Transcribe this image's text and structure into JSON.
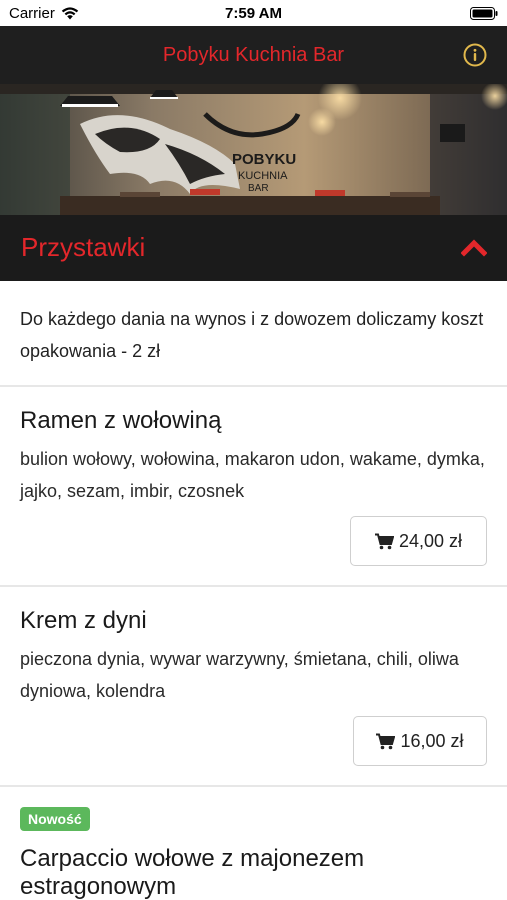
{
  "status_bar": {
    "carrier": "Carrier",
    "time": "7:59 AM"
  },
  "nav": {
    "title": "Pobyku Kuchnia Bar",
    "info_icon": "info-circle-icon"
  },
  "hero": {
    "sign_line1": "POBYKU",
    "sign_line2": "KUCHNIA",
    "sign_line3": "BAR"
  },
  "section": {
    "title": "Przystawki",
    "toggle_icon": "chevron-up-icon"
  },
  "notice": "Do każdego dania na wynos i z dowozem doliczamy koszt opakowania - 2 zł",
  "items": [
    {
      "name": "Ramen z wołowiną",
      "description": "bulion wołowy, wołowina, makaron udon, wakame, dymka, jajko, sezam, imbir, czosnek",
      "price": "24,00 zł"
    },
    {
      "name": "Krem z dyni",
      "description": "pieczona dynia, wywar warzywny, śmietana, chili, oliwa dyniowa, kolendra",
      "price": "16,00 zł"
    },
    {
      "badge": "Nowość",
      "name": "Carpaccio wołowe z majonezem estragonowym"
    }
  ],
  "colors": {
    "accent": "#e3272b",
    "nav_bg": "#1f1f1f",
    "badge": "#5cb85c",
    "info_icon": "#e1b84c"
  }
}
